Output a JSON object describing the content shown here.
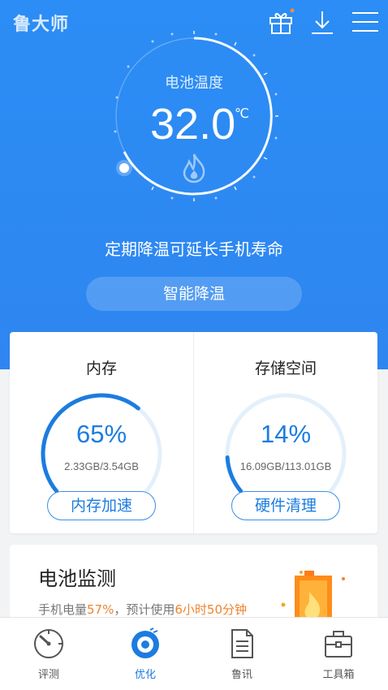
{
  "app": {
    "logo": "鲁大师"
  },
  "header": {
    "icons": [
      "gift-icon",
      "download-icon",
      "menu-icon"
    ]
  },
  "battery_temp": {
    "title": "电池温度",
    "value": "32.0",
    "unit": "℃",
    "tip": "定期降温可延长手机寿命",
    "button": "智能降温"
  },
  "memory": {
    "title": "内存",
    "percent": "65%",
    "level": 0.65,
    "detail": "2.33GB/3.54GB",
    "button": "内存加速"
  },
  "storage": {
    "title": "存储空间",
    "percent": "14%",
    "level": 0.14,
    "detail": "16.09GB/113.01GB",
    "button": "硬件清理"
  },
  "battery_monitor": {
    "title": "电池监测",
    "info_prefix": "手机电量",
    "charge": "57%",
    "info_mid": "，预计使用",
    "remaining": "6小时50分钟"
  },
  "tabs": [
    {
      "label": "评测",
      "icon": "speedometer-icon"
    },
    {
      "label": "优化",
      "icon": "optimize-icon"
    },
    {
      "label": "鲁讯",
      "icon": "document-icon"
    },
    {
      "label": "工具箱",
      "icon": "toolbox-icon"
    }
  ],
  "colors": {
    "primary": "#2b8df5",
    "accent_blue": "#1c7ce0",
    "highlight_orange": "#f0832c"
  }
}
